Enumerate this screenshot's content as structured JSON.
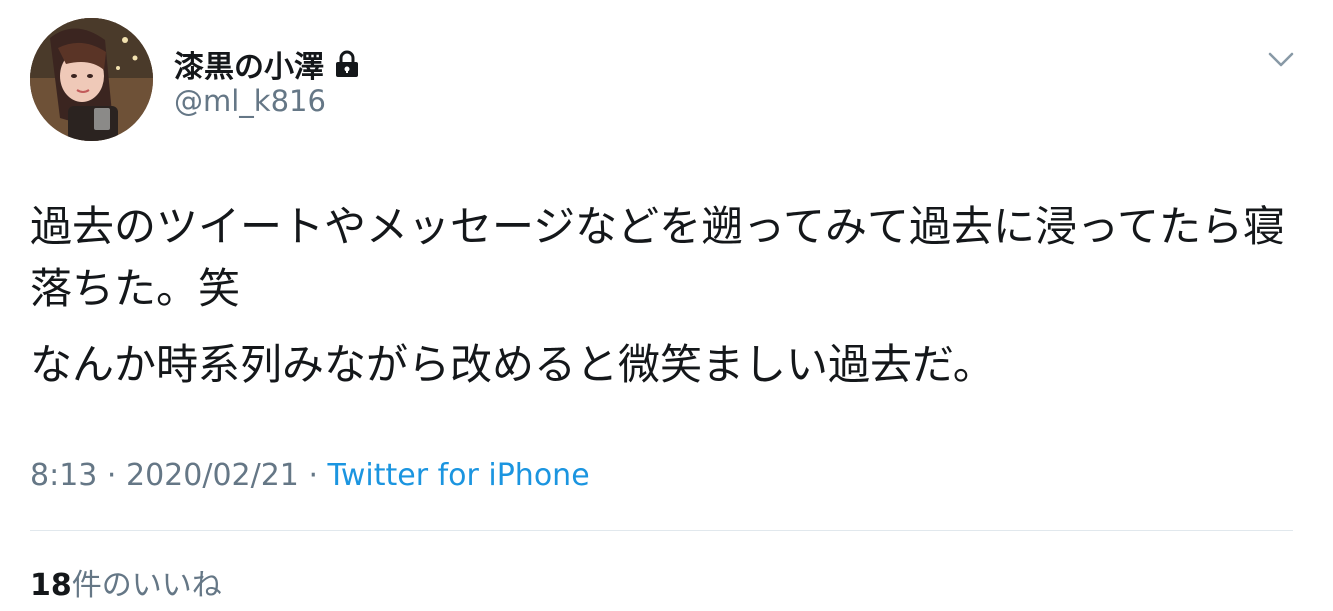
{
  "author": {
    "display_name": "漆黒の小澤",
    "handle": "@ml_k816",
    "protected_icon": "lock-icon",
    "avatar_icon": "profile-photo"
  },
  "menu": {
    "icon": "chevron-down-icon"
  },
  "tweet": {
    "paragraph1": "過去のツイートやメッセージなどを遡ってみて過去に浸ってたら寝落ちた。笑",
    "paragraph2": "なんか時系列みながら改めると微笑ましい過去だ。"
  },
  "meta": {
    "time": "8:13",
    "separator1": " · ",
    "date": "2020/02/21",
    "separator2": " · ",
    "source": "Twitter for iPhone"
  },
  "stats": {
    "likes_count": "18",
    "likes_label": "件のいいね"
  },
  "colors": {
    "primary_text": "#14171a",
    "secondary_text": "#657786",
    "link": "#1b95e0",
    "divider": "#e1e8ed"
  }
}
